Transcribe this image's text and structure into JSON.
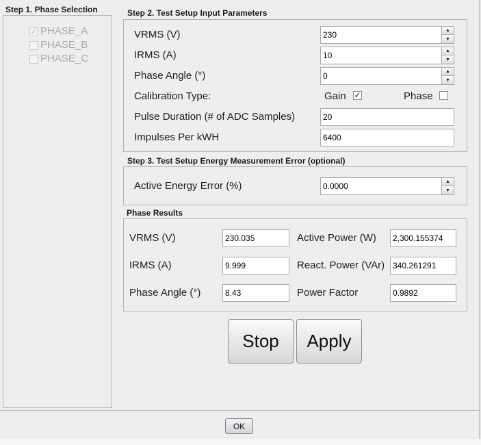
{
  "step1": {
    "title": "Step 1. Phase Selection",
    "phases": [
      {
        "label": "PHASE_A",
        "checked": true
      },
      {
        "label": "PHASE_B",
        "checked": false
      },
      {
        "label": "PHASE_C",
        "checked": false
      }
    ]
  },
  "step2": {
    "title": "Step 2. Test Setup Input Parameters",
    "vrms_label": "VRMS (V)",
    "vrms_value": "230",
    "irms_label": "IRMS (A)",
    "irms_value": "10",
    "phase_angle_label": "Phase Angle (°)",
    "phase_angle_value": "0",
    "calibration_label": "Calibration Type:",
    "gain_label": "Gain",
    "gain_checked": true,
    "phase_label": "Phase",
    "phase_checked": false,
    "pulse_label": "Pulse Duration (# of ADC Samples)",
    "pulse_value": "20",
    "impulses_label": "Impulses Per kWH",
    "impulses_value": "6400"
  },
  "step3": {
    "title": "Step 3. Test Setup Energy Measurement Error (optional)",
    "active_error_label": "Active Energy Error (%)",
    "active_error_value": "0.0000"
  },
  "results": {
    "title": "Phase Results",
    "vrms_label": "VRMS (V)",
    "vrms_value": "230.035",
    "irms_label": "IRMS (A)",
    "irms_value": "9.999",
    "phase_angle_label": "Phase Angle (°)",
    "phase_angle_value": "8.43",
    "active_power_label": "Active Power (W)",
    "active_power_value": "2,300.155374",
    "react_power_label": "React. Power (VAr)",
    "react_power_value": "340.261291",
    "power_factor_label": "Power Factor",
    "power_factor_value": "0.9892"
  },
  "buttons": {
    "stop": "Stop",
    "apply": "Apply",
    "ok": "OK"
  },
  "icons": {
    "check": "✓",
    "spin_up": "▲",
    "spin_down": "▼"
  }
}
